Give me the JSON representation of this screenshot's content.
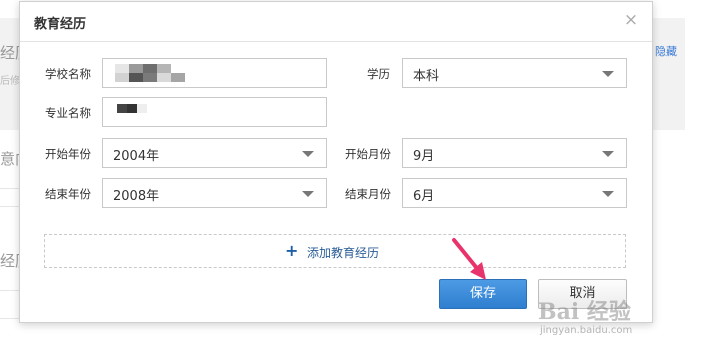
{
  "background": {
    "heading_1": "经历",
    "sub_1": "后修",
    "link": "隐藏",
    "heading_2": "意向",
    "heading_3": "经历"
  },
  "dialog": {
    "title": "教育经历",
    "close_symbol": "×",
    "fields": {
      "school_label": "学校名称",
      "degree_label": "学历",
      "degree_value": "本科",
      "major_label": "专业名称",
      "start_year_label": "开始年份",
      "start_year_value": "2004年",
      "start_month_label": "开始月份",
      "start_month_value": "9月",
      "end_year_label": "结束年份",
      "end_year_value": "2008年",
      "end_month_label": "结束月份",
      "end_month_value": "6月"
    },
    "add_button": {
      "icon": "plus-icon",
      "symbol": "+",
      "label": "添加教育经历"
    },
    "save_label": "保存",
    "cancel_label": "取消"
  },
  "watermark": {
    "main": "Bai 经验",
    "url": "jingyan.baidu.com"
  },
  "colors": {
    "primary_button": "#3a88d8",
    "link": "#2a5d97",
    "annotation_arrow": "#e8336d"
  }
}
